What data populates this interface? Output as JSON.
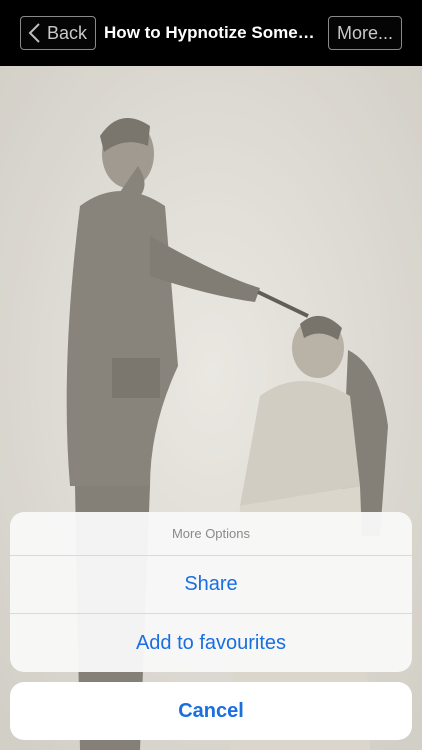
{
  "navbar": {
    "back_label": "Back",
    "title": "How to Hypnotize Someo...",
    "more_label": "More..."
  },
  "action_sheet": {
    "title": "More Options",
    "items": [
      {
        "label": "Share"
      },
      {
        "label": "Add to favourites"
      }
    ],
    "cancel_label": "Cancel"
  },
  "colors": {
    "accent": "#1a6fe0",
    "navbar_bg": "#000000"
  },
  "icons": {
    "back": "chevron-left-icon"
  }
}
